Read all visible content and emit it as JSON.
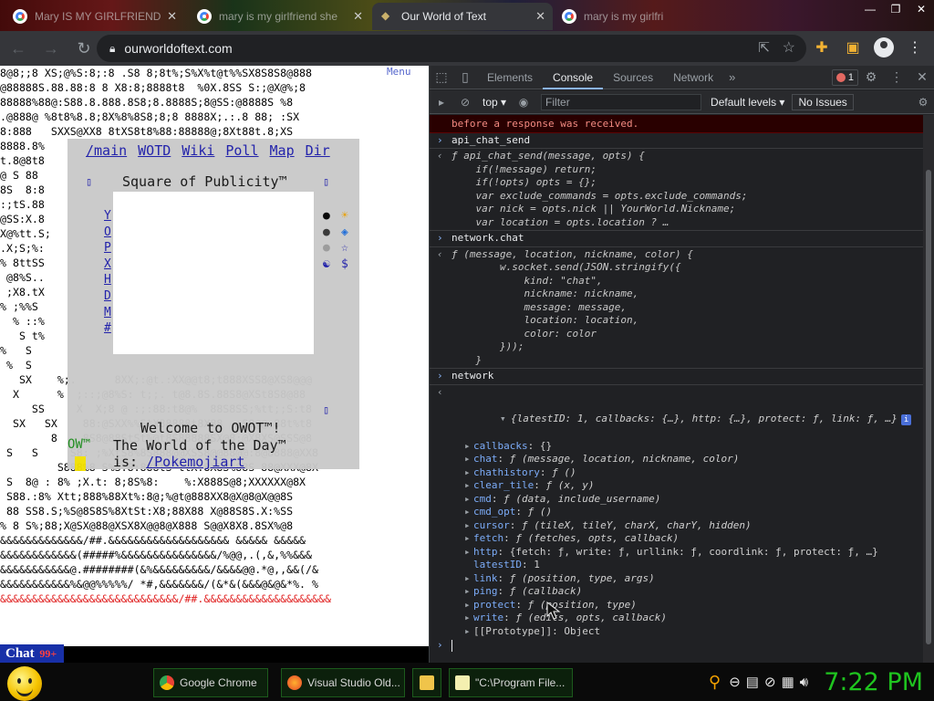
{
  "browser": {
    "tabs": [
      {
        "title": "Mary IS MY GIRLFRIEND",
        "active": false
      },
      {
        "title": "mary is my girlfriend she",
        "active": false
      },
      {
        "title": "Our World of Text",
        "active": true
      },
      {
        "title": "mary is my girlfri",
        "active": false
      }
    ],
    "url": "ourworldoftext.com"
  },
  "page": {
    "menu_label": "Menu",
    "nav": [
      "/main",
      "WOTD",
      "Wiki",
      "Poll",
      "Map",
      "Dir"
    ],
    "square_title": "Square of Publicity™",
    "side_letters": [
      "Y",
      "O",
      "P",
      "X",
      "H",
      "D",
      "M",
      "#"
    ],
    "welcome": "Welcome to OWOT™!",
    "wotd_label": "The World of the Day™",
    "wotd_prefix": "is:",
    "wotd_link": "/Pokemojiart",
    "ow_mark": "OW™",
    "chat_label": "Chat",
    "chat_count": "99+"
  },
  "devtools": {
    "tabs": [
      "Elements",
      "Console",
      "Sources",
      "Network"
    ],
    "active_tab": "Console",
    "error_count": "1",
    "context": "top",
    "filter_placeholder": "Filter",
    "levels": "Default levels",
    "issues": "No Issues",
    "console": {
      "error_tail": "before a response was received.",
      "cmd1": "api_chat_send",
      "fn1": [
        "ƒ api_chat_send(message, opts) {",
        "    if(!message) return;",
        "    if(!opts) opts = {};",
        "    var exclude_commands = opts.exclude_commands;",
        "    var nick = opts.nick || YourWorld.Nickname;",
        "    var location = opts.location ? …"
      ],
      "cmd2": "network.chat",
      "fn2": [
        "ƒ (message, location, nickname, color) {",
        "        w.socket.send(JSON.stringify({",
        "            kind: \"chat\",",
        "            nickname: nickname,",
        "            message: message,",
        "            location: location,",
        "            color: color",
        "        }));",
        "    }"
      ],
      "cmd3": "network",
      "summary": "{latestID: 1, callbacks: {…}, http: {…}, protect: ƒ, link: ƒ, …}",
      "summary_badge": "i",
      "props": [
        {
          "key": "callbacks",
          "val": "{}"
        },
        {
          "key": "chat",
          "val": "ƒ (message, location, nickname, color)"
        },
        {
          "key": "chathistory",
          "val": "ƒ ()"
        },
        {
          "key": "clear_tile",
          "val": "ƒ (x, y)"
        },
        {
          "key": "cmd",
          "val": "ƒ (data, include_username)"
        },
        {
          "key": "cmd_opt",
          "val": "ƒ ()"
        },
        {
          "key": "cursor",
          "val": "ƒ (tileX, tileY, charX, charY, hidden)"
        },
        {
          "key": "fetch",
          "val": "ƒ (fetches, opts, callback)"
        },
        {
          "key": "http",
          "val": "{fetch: ƒ, write: ƒ, urllink: ƒ, coordlink: ƒ, protect: ƒ, …}"
        },
        {
          "key": "latestID",
          "val": "1"
        },
        {
          "key": "link",
          "val": "ƒ (position, type, args)"
        },
        {
          "key": "ping",
          "val": "ƒ (callback)"
        },
        {
          "key": "protect",
          "val": "ƒ (position, type)"
        },
        {
          "key": "write",
          "val": "ƒ (edits, opts, callback)"
        },
        {
          "key": "[[Prototype]]",
          "val": "Object"
        }
      ]
    }
  },
  "taskbar": {
    "tasks": [
      {
        "label": "Google Chrome",
        "icon": "chrome-icon"
      },
      {
        "label": "Visual Studio Old...",
        "icon": "firefox-icon"
      },
      {
        "label": "",
        "icon": "folder-icon"
      },
      {
        "label": "\"C:\\Program File...",
        "icon": "notepad-icon"
      }
    ],
    "clock": "7:22 PM"
  }
}
